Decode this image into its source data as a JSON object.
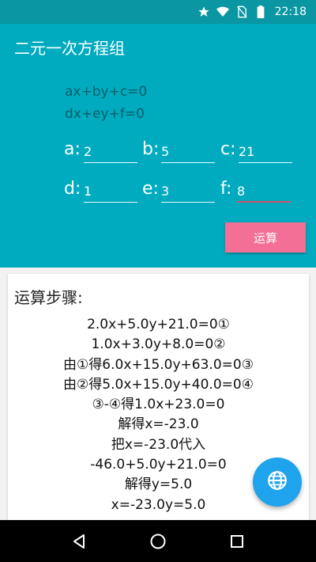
{
  "status_bar": {
    "time": "22:18",
    "icons": [
      "star-icon",
      "wifi-icon",
      "no-sim-icon",
      "battery-icon"
    ]
  },
  "app_bar": {
    "title": "二元一次方程组"
  },
  "equations": {
    "line1": "ax+by+c=0",
    "line2": "dx+ey+f=0"
  },
  "coefficients": {
    "a": {
      "label": "a:",
      "value": "2"
    },
    "b": {
      "label": "b:",
      "value": "5"
    },
    "c": {
      "label": "c:",
      "value": "21"
    },
    "d": {
      "label": "d:",
      "value": "1"
    },
    "e": {
      "label": "e:",
      "value": "3"
    },
    "f": {
      "label": "f:",
      "value": "8"
    }
  },
  "calc_button": {
    "label": "运算"
  },
  "steps_card": {
    "title": "运算步骤:",
    "steps": [
      "2.0x+5.0y+21.0=0①",
      "1.0x+3.0y+8.0=0②",
      "由①得6.0x+15.0y+63.0=0③",
      "由②得5.0x+15.0y+40.0=0④",
      "③-④得1.0x+23.0=0",
      "解得x=-23.0",
      "把x=-23.0代入",
      "-46.0+5.0y+21.0=0",
      "解得y=5.0",
      "x=-23.0y=5.0"
    ]
  },
  "fab": {
    "icon": "globe-icon"
  },
  "nav_bar": {
    "icons": [
      "back-icon",
      "home-icon",
      "recents-icon"
    ]
  },
  "colors": {
    "primary": "#00abbf",
    "primary_dark": "#0a97a3",
    "accent": "#f36f95",
    "fab": "#1ea3ec"
  }
}
